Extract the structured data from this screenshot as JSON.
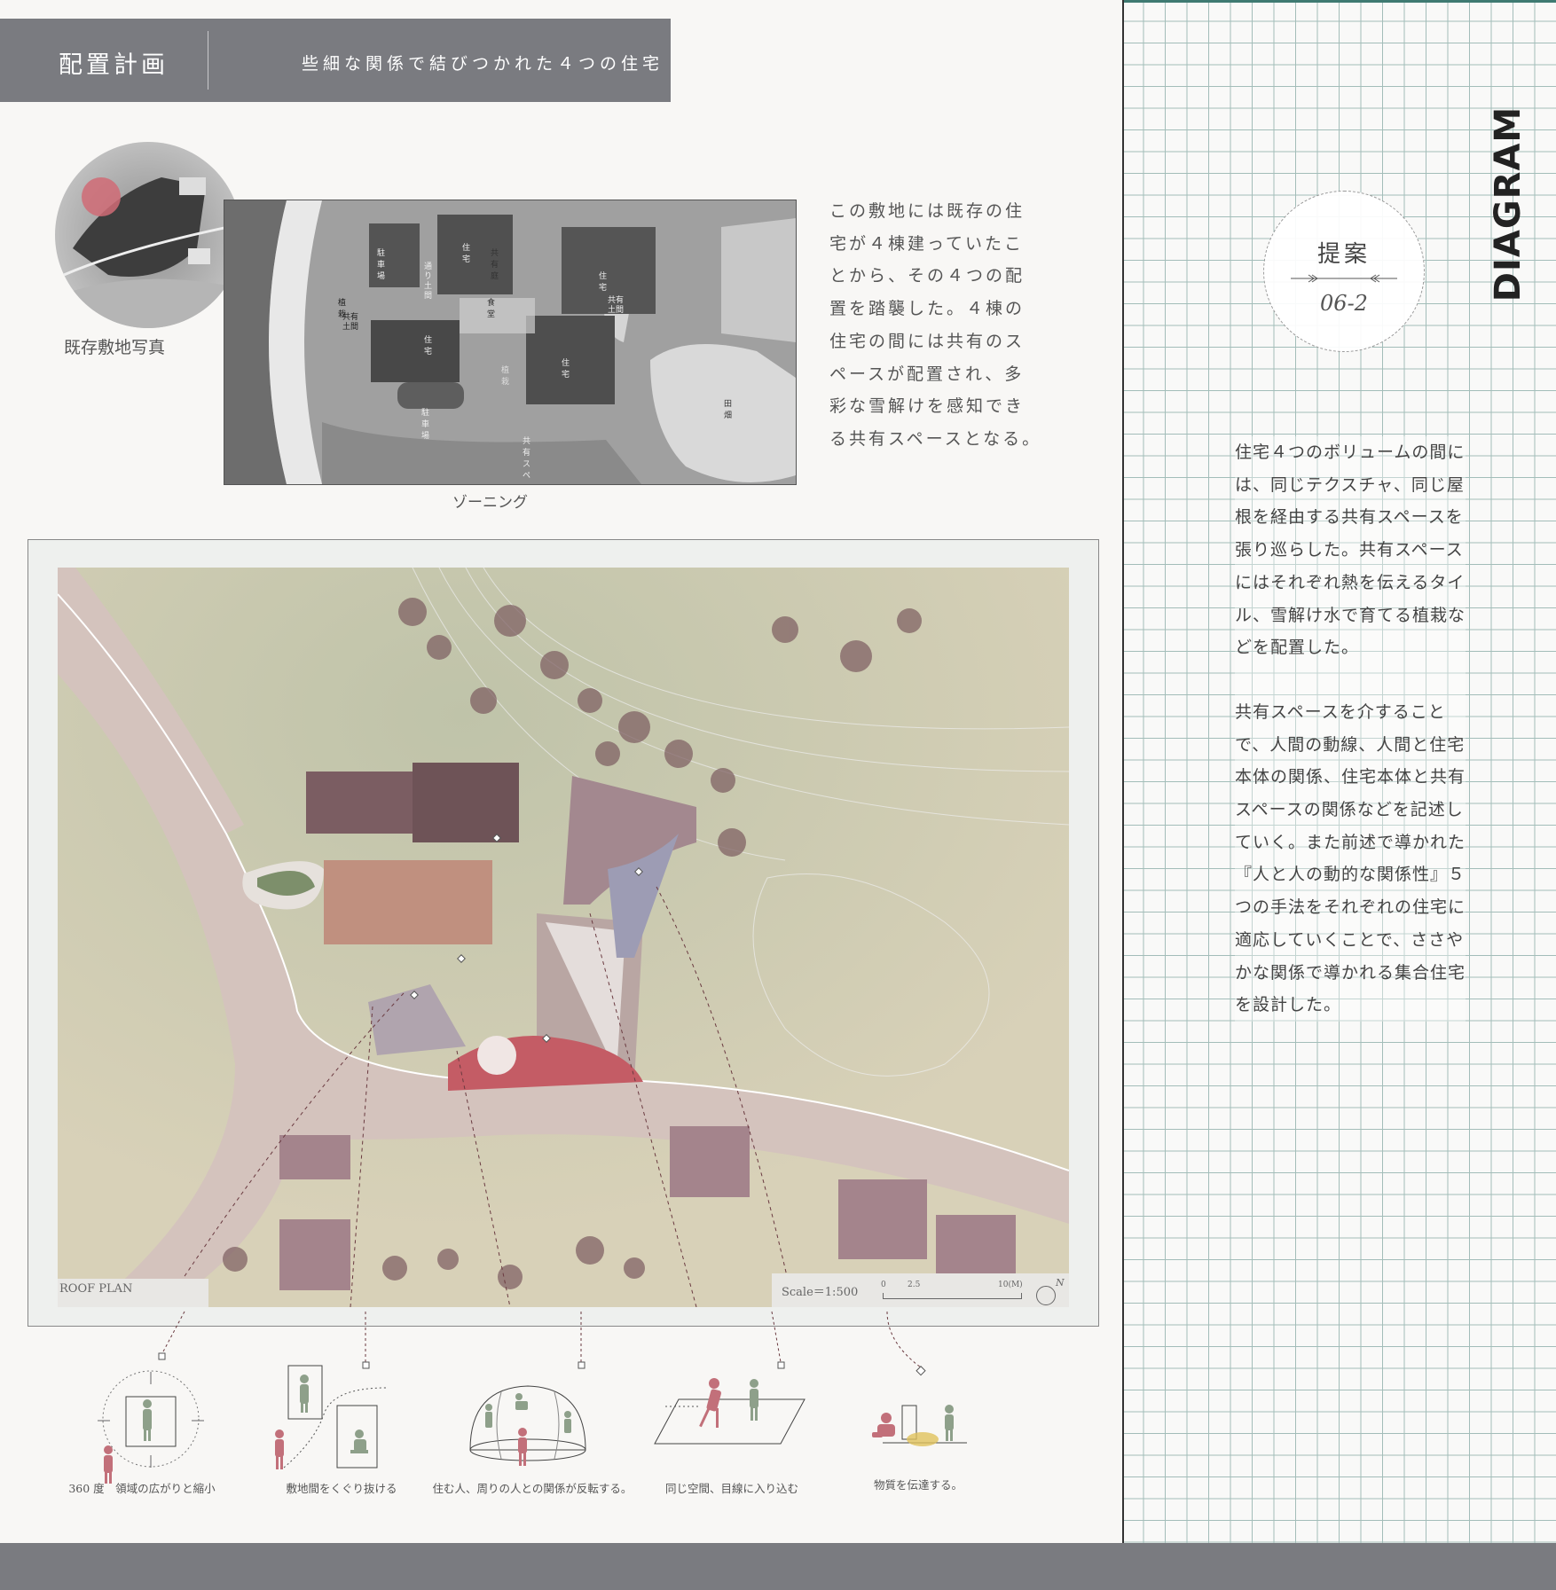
{
  "header": {
    "title": "配置計画",
    "subtitle": "些細な関係で結びつかれた４つの住宅"
  },
  "site_photo": {
    "caption": "既存敷地写真"
  },
  "zoning": {
    "caption": "ゾーニング",
    "labels": {
      "parking_top": "駐車場",
      "passage": "通り土間",
      "house_top": "住宅",
      "shared_garden": "共有庭",
      "house_right": "住宅",
      "planting_left": "植栽",
      "shared_earth_left": "共有土間",
      "dining": "食堂",
      "shared_earth_right": "共有土間",
      "house_left": "住宅",
      "planting_mid": "植栽",
      "house_center": "住宅",
      "field": "田畑",
      "parking_bottom": "駐車場",
      "shared_space": "共有スペース"
    }
  },
  "zoning_text": "この敷地には既存の住宅が４棟建っていたことから、その４つの配置を踏襲した。４棟の住宅の間には共有のスペースが配置され、多彩な雪解けを感知できる共有スペースとなる。",
  "roof_plan": {
    "label": "ROOF PLAN",
    "scale": "Scale＝1:500",
    "scale_ticks": [
      "0",
      "2.5",
      "10(M)"
    ],
    "north": "N"
  },
  "diagrams": [
    {
      "caption": "360 度　領域の広がりと縮小"
    },
    {
      "caption": "敷地間をくぐり抜ける"
    },
    {
      "caption": "住む人、周りの人との関係が反転する。"
    },
    {
      "caption": "同じ空間、目線に入り込む"
    },
    {
      "caption": "物質を伝達する。"
    }
  ],
  "right_panel": {
    "vertical_title": "DIAGRAM",
    "badge_title": "提案",
    "badge_number": "06-2",
    "text_p1": "住宅４つのボリュームの間には、同じテクスチャ、同じ屋根を経由する共有スペースを張り巡らした。共有スペースにはそれぞれ熱を伝えるタイル、雪解け水で育てる植栽などを配置した。",
    "text_p2": "共有スペースを介することで、人間の動線、人間と住宅本体の関係、住宅本体と共有スペースの関係などを記述していく。また前述で導かれた『人と人の動的な関係性』５つの手法をそれぞれの住宅に適応していくことで、ささやかな関係で導かれる集合住宅を設計した。"
  },
  "colors": {
    "header_bg": "#7a7b80",
    "grid_line": "#5f8e89",
    "accent_red": "#c2707a",
    "accent_green": "#8ea08a"
  }
}
